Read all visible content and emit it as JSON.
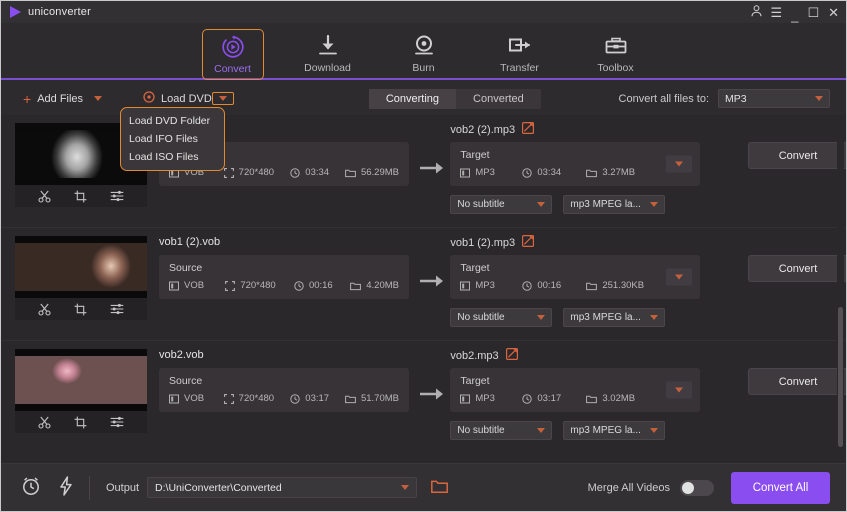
{
  "titlebar": {
    "app_title": "uniconverter",
    "icons": [
      "account-icon",
      "menu-icon",
      "minimize-icon",
      "maximize-icon",
      "close-icon"
    ],
    "minimize": "_",
    "maximize": "☐",
    "close": "✕",
    "menu": "☰",
    "account": "⛉"
  },
  "nav": {
    "items": [
      {
        "label": "Convert",
        "icon": "convert-icon",
        "active": true
      },
      {
        "label": "Download",
        "icon": "download-icon",
        "active": false
      },
      {
        "label": "Burn",
        "icon": "burn-icon",
        "active": false
      },
      {
        "label": "Transfer",
        "icon": "transfer-icon",
        "active": false
      },
      {
        "label": "Toolbox",
        "icon": "toolbox-icon",
        "active": false
      }
    ],
    "accent_color": "#e08a33",
    "active_text_color": "#9a6ef0"
  },
  "toolbar": {
    "add_files_label": "Add Files",
    "load_dvd_label": "Load DVD",
    "tabs": [
      {
        "label": "Converting",
        "active": true
      },
      {
        "label": "Converted",
        "active": false
      }
    ],
    "convert_all_to_label": "Convert all files to:",
    "convert_all_to_value": "MP3"
  },
  "dvd_menu": {
    "open": true,
    "items": [
      "Load DVD Folder",
      "Load IFO Files",
      "Load ISO Files"
    ],
    "border_color": "#e08a33"
  },
  "list": {
    "source_block_title": "Source",
    "target_block_title": "Target",
    "convert_button_label": "Convert",
    "rows": [
      {
        "thumb": "portrait-bw",
        "source": {
          "name": "",
          "format": "VOB",
          "resolution": "720*480",
          "duration": "03:34",
          "size": "56.29MB"
        },
        "target": {
          "name": "vob2 (2).mp3",
          "format": "MP3",
          "duration": "03:34",
          "size": "3.27MB",
          "subtitle": "No subtitle",
          "codec": "mp3 MPEG la..."
        }
      },
      {
        "thumb": "couple-scene",
        "source": {
          "name": "vob1 (2).vob",
          "format": "VOB",
          "resolution": "720*480",
          "duration": "00:16",
          "size": "4.20MB"
        },
        "target": {
          "name": "vob1 (2).mp3",
          "format": "MP3",
          "duration": "00:16",
          "size": "251.30KB",
          "subtitle": "No subtitle",
          "codec": "mp3 MPEG la..."
        }
      },
      {
        "thumb": "roses-hands",
        "source": {
          "name": "vob2.vob",
          "format": "VOB",
          "resolution": "720*480",
          "duration": "03:17",
          "size": "51.70MB"
        },
        "target": {
          "name": "vob2.mp3",
          "format": "MP3",
          "duration": "03:17",
          "size": "3.02MB",
          "subtitle": "No subtitle",
          "codec": "mp3 MPEG la..."
        }
      }
    ]
  },
  "bottom": {
    "output_label": "Output",
    "output_path": "D:\\UniConverter\\Converted",
    "merge_label": "Merge All Videos",
    "merge_enabled": false,
    "convert_all_label": "Convert All",
    "accent_color": "#8a4df0"
  }
}
